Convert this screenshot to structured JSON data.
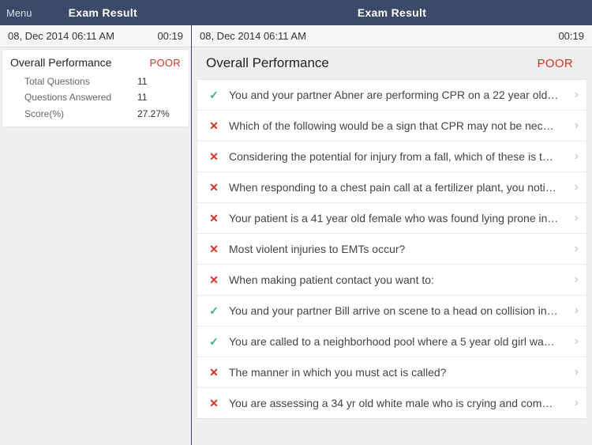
{
  "left": {
    "menu_label": "Menu",
    "header_title": "Exam Result",
    "date": "08, Dec 2014 06:11 AM",
    "timer": "00:19",
    "perf_title": "Overall Performance",
    "perf_status": "POOR",
    "stats": [
      {
        "label": "Total Questions",
        "value": "11"
      },
      {
        "label": "Questions Answered",
        "value": "11"
      },
      {
        "label": "Score(%)",
        "value": "27.27%"
      }
    ]
  },
  "right": {
    "header_title": "Exam Result",
    "date": "08, Dec 2014 06:11 AM",
    "timer": "00:19",
    "perf_title": "Overall Performance",
    "perf_status": "POOR",
    "questions": [
      {
        "correct": true,
        "text": "You and your partner Abner are performing CPR on a 22 year old…"
      },
      {
        "correct": false,
        "text": "Which of the following would be a sign that CPR may not be nec…"
      },
      {
        "correct": false,
        "text": "Considering the potential for injury from a fall, which of these is t…"
      },
      {
        "correct": false,
        "text": "When responding to a chest pain call at a fertilizer plant, you noti…"
      },
      {
        "correct": false,
        "text": "Your patient is a 41 year old female who was found lying prone in…"
      },
      {
        "correct": false,
        "text": "Most violent injuries to EMTs occur?"
      },
      {
        "correct": false,
        "text": "When making patient contact you want to:"
      },
      {
        "correct": true,
        "text": "You and your partner Bill arrive on scene to a head on collision in…"
      },
      {
        "correct": true,
        "text": "You are called to a neighborhood pool where a 5 year old girl wa…"
      },
      {
        "correct": false,
        "text": "The manner in which you must act is called?"
      },
      {
        "correct": false,
        "text": "You are assessing a 34 yr old white male who is crying and com…"
      }
    ]
  },
  "glyphs": {
    "check": "✓",
    "cross": "✕",
    "chevron": "›"
  }
}
